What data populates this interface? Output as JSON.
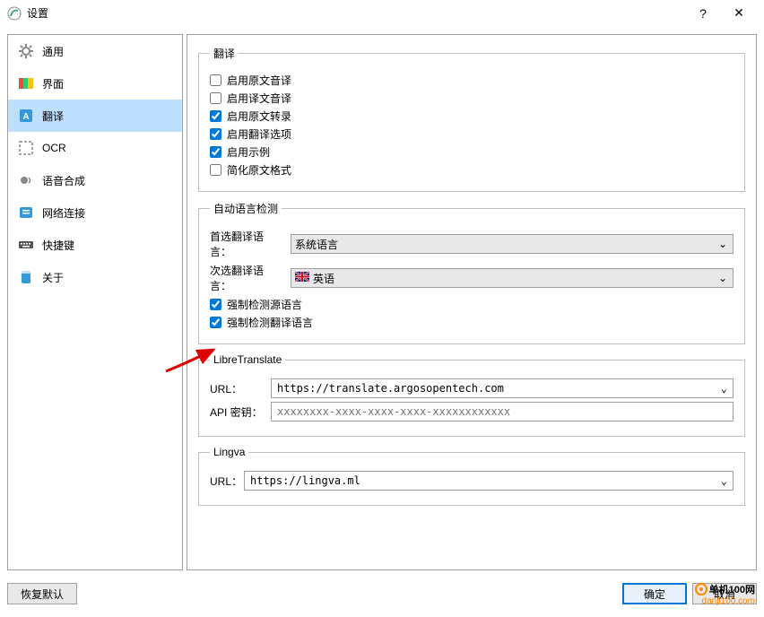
{
  "titlebar": {
    "title": "设置",
    "help": "?",
    "close": "✕"
  },
  "sidebar": {
    "items": [
      {
        "label": "通用"
      },
      {
        "label": "界面"
      },
      {
        "label": "翻译"
      },
      {
        "label": "OCR"
      },
      {
        "label": "语音合成"
      },
      {
        "label": "网络连接"
      },
      {
        "label": "快捷键"
      },
      {
        "label": "关于"
      }
    ]
  },
  "groups": {
    "translation": {
      "legend": "翻译",
      "opts": [
        {
          "label": "启用原文音译",
          "checked": false
        },
        {
          "label": "启用译文音译",
          "checked": false
        },
        {
          "label": "启用原文转录",
          "checked": true
        },
        {
          "label": "启用翻译选项",
          "checked": true
        },
        {
          "label": "启用示例",
          "checked": true
        },
        {
          "label": "简化原文格式",
          "checked": false
        }
      ]
    },
    "autolang": {
      "legend": "自动语言检测",
      "pref_label": "首选翻译语言：",
      "pref_value": "系统语言",
      "sec_label": "次选翻译语言：",
      "sec_value": "英语",
      "force_src": {
        "label": "强制检测源语言",
        "checked": true
      },
      "force_trans": {
        "label": "强制检测翻译语言",
        "checked": true
      }
    },
    "libretranslate": {
      "legend": "LibreTranslate",
      "url_label": "URL：",
      "url_value": "https://translate.argosopentech.com",
      "apikey_label": "API 密钥：",
      "apikey_placeholder": "xxxxxxxx-xxxx-xxxx-xxxx-xxxxxxxxxxxx"
    },
    "lingva": {
      "legend": "Lingva",
      "url_label": "URL：",
      "url_value": "https://lingva.ml"
    }
  },
  "buttons": {
    "restore": "恢复默认",
    "ok": "确定",
    "cancel": "取消"
  },
  "watermark": {
    "cn": "单机100网",
    "url": "danji100.com"
  }
}
